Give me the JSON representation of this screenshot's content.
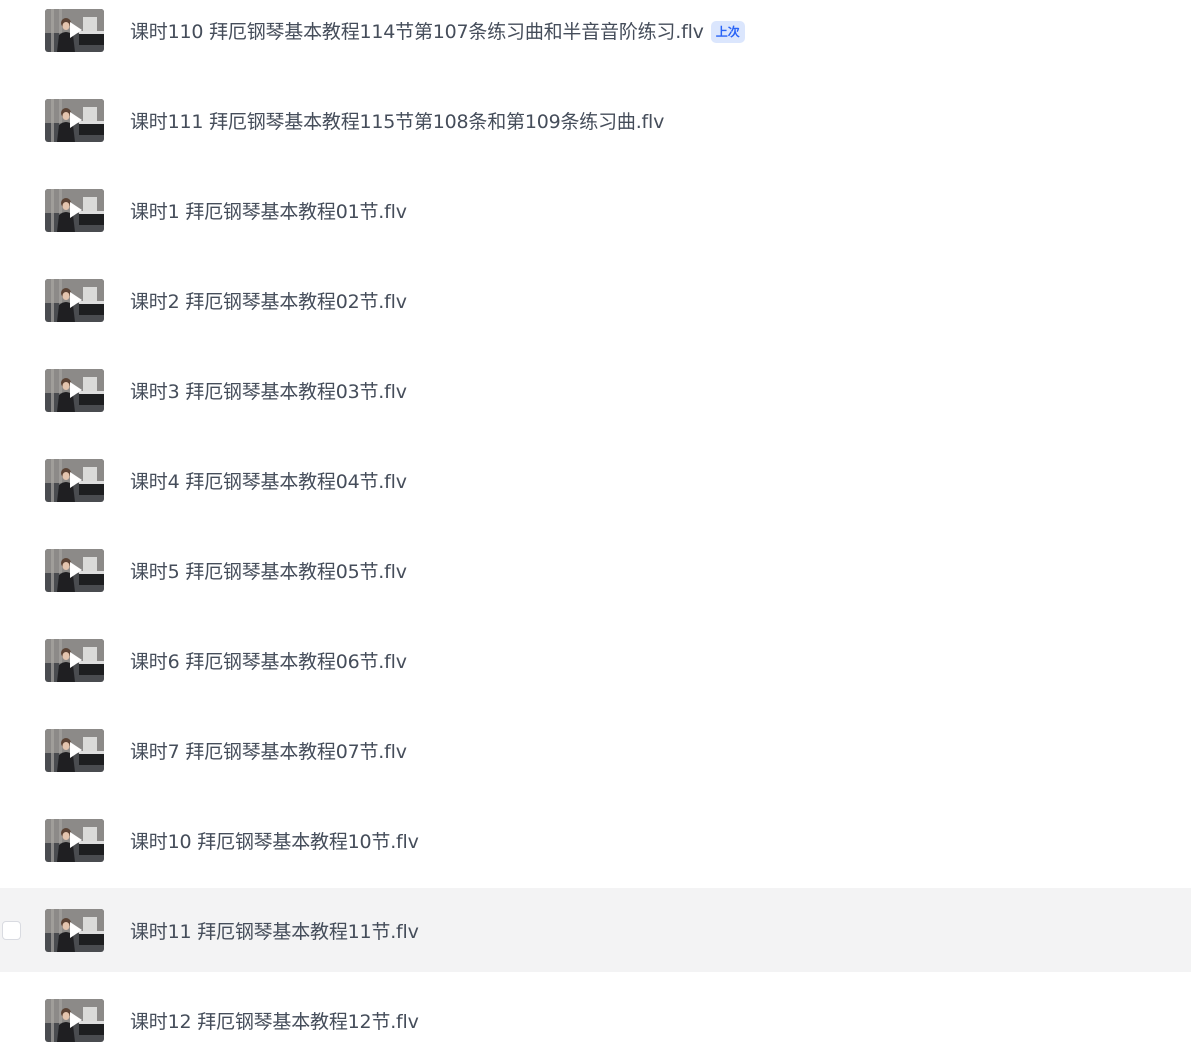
{
  "files": [
    {
      "name": "课时110 拜厄钢琴基本教程114节第107条练习曲和半音音阶练习.flv",
      "badge": "上次",
      "hovered": false
    },
    {
      "name": "课时111 拜厄钢琴基本教程115节第108条和第109条练习曲.flv",
      "badge": "",
      "hovered": false
    },
    {
      "name": "课时1 拜厄钢琴基本教程01节.flv",
      "badge": "",
      "hovered": false
    },
    {
      "name": "课时2 拜厄钢琴基本教程02节.flv",
      "badge": "",
      "hovered": false
    },
    {
      "name": "课时3 拜厄钢琴基本教程03节.flv",
      "badge": "",
      "hovered": false
    },
    {
      "name": "课时4 拜厄钢琴基本教程04节.flv",
      "badge": "",
      "hovered": false
    },
    {
      "name": "课时5 拜厄钢琴基本教程05节.flv",
      "badge": "",
      "hovered": false
    },
    {
      "name": "课时6 拜厄钢琴基本教程06节.flv",
      "badge": "",
      "hovered": false
    },
    {
      "name": "课时7 拜厄钢琴基本教程07节.flv",
      "badge": "",
      "hovered": false
    },
    {
      "name": "课时10 拜厄钢琴基本教程10节.flv",
      "badge": "",
      "hovered": false
    },
    {
      "name": "课时11 拜厄钢琴基本教程11节.flv",
      "badge": "",
      "hovered": true
    },
    {
      "name": "课时12 拜厄钢琴基本教程12节.flv",
      "badge": "",
      "hovered": false
    }
  ],
  "icons": {
    "thumbnail": "video-thumbnail",
    "play": "play-icon",
    "checkbox": "checkbox"
  },
  "colors": {
    "text": "#454d5a",
    "hover_bg": "#f3f3f4",
    "badge_text": "#2a64f6",
    "badge_bg": "#dbe6fd"
  }
}
